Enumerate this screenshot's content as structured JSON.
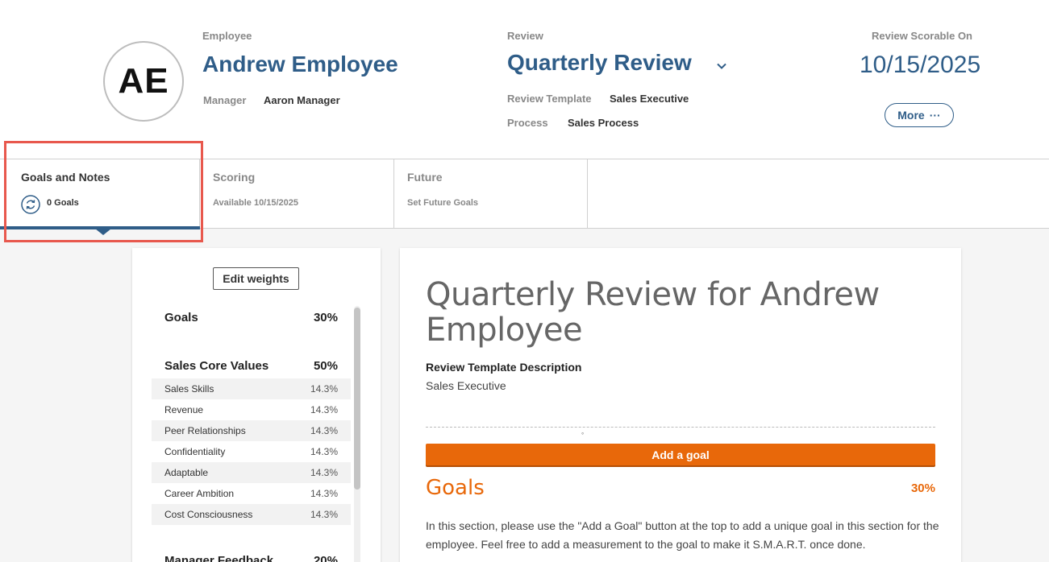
{
  "header": {
    "avatar_initials": "AE",
    "employee_label": "Employee",
    "employee_name": "Andrew Employee",
    "manager_label": "Manager",
    "manager_name": "Aaron Manager",
    "review_label": "Review",
    "review_name": "Quarterly Review",
    "template_label": "Review Template",
    "template_value": "Sales Executive",
    "process_label": "Process",
    "process_value": "Sales Process",
    "scorable_label": "Review Scorable On",
    "scorable_date": "10/15/2025",
    "more_label": "More",
    "more_dots": "···"
  },
  "tabs": [
    {
      "title": "Goals and Notes",
      "sub": "0 Goals",
      "active": true
    },
    {
      "title": "Scoring",
      "sub": "Available 10/15/2025"
    },
    {
      "title": "Future",
      "sub": "Set Future Goals"
    }
  ],
  "weights": {
    "edit_label": "Edit weights",
    "sections": [
      {
        "name": "Goals",
        "pct": "30%",
        "items": []
      },
      {
        "name": "Sales Core Values",
        "pct": "50%",
        "items": [
          {
            "name": "Sales Skills",
            "pct": "14.3%"
          },
          {
            "name": "Revenue",
            "pct": "14.3%"
          },
          {
            "name": "Peer Relationships",
            "pct": "14.3%"
          },
          {
            "name": "Confidentiality",
            "pct": "14.3%"
          },
          {
            "name": "Adaptable",
            "pct": "14.3%"
          },
          {
            "name": "Career Ambition",
            "pct": "14.3%"
          },
          {
            "name": "Cost Consciousness",
            "pct": "14.3%"
          }
        ]
      },
      {
        "name": "Manager Feedback",
        "pct": "20%",
        "items": []
      }
    ]
  },
  "main": {
    "title": "Quarterly Review for Andrew Employee",
    "desc_label": "Review Template Description",
    "desc_value": "Sales Executive",
    "dot": "°",
    "add_goal_label": "Add a goal",
    "goals_title": "Goals",
    "goals_pct": "30%",
    "goals_text": "In this section, please use the \"Add a Goal\" button at the top to add a unique goal in this section for the employee.  Feel free to add a measurement to the goal to make it S.M.A.R.T. once done."
  },
  "colors": {
    "accent": "#2f5d88",
    "orange": "#e8680a",
    "highlight": "#e8584d"
  }
}
